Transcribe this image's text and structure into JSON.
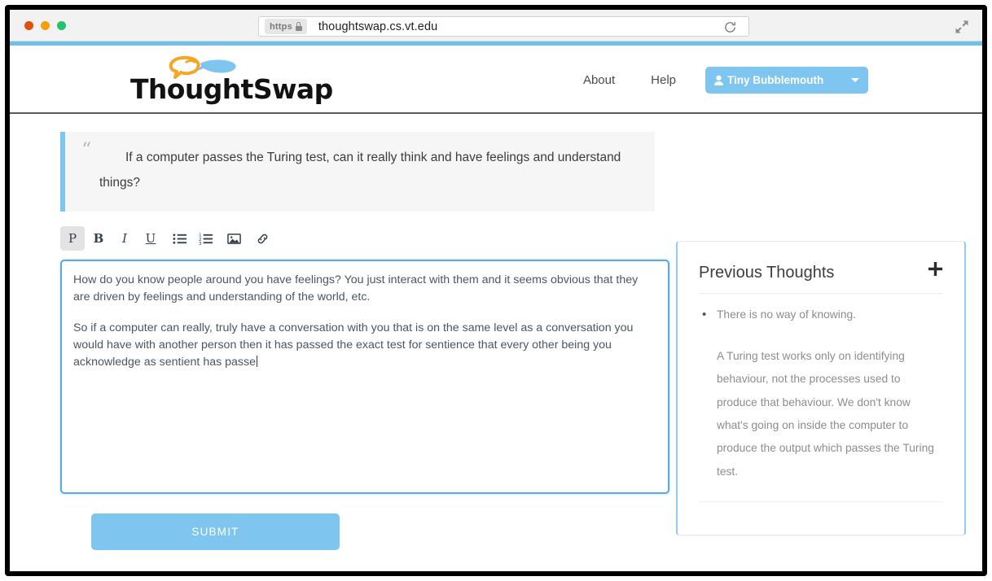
{
  "browser": {
    "scheme_badge": "https",
    "url": "thoughtswap.cs.vt.edu",
    "reload_icon": "reload-icon",
    "expand_icon": "fullscreen-icon"
  },
  "header": {
    "logo_text": "ThoughtSwap",
    "nav": [
      {
        "label": "About"
      },
      {
        "label": "Help"
      }
    ],
    "user": {
      "name": "Tiny Bubblemouth",
      "icon": "user-icon",
      "caret": "chevron-down-icon"
    }
  },
  "prompt": {
    "quote_glyph": "“",
    "text": "If a computer passes the Turing test, can it really think and have feelings and understand things?"
  },
  "toolbar": {
    "items": [
      {
        "name": "paragraph",
        "label": "P",
        "active": true
      },
      {
        "name": "bold",
        "label": "B",
        "active": false
      },
      {
        "name": "italic",
        "label": "I",
        "active": false
      },
      {
        "name": "underline",
        "label": "U",
        "active": false
      },
      {
        "name": "bullet-list",
        "label": "",
        "active": false
      },
      {
        "name": "numbered-list",
        "label": "",
        "active": false
      },
      {
        "name": "image",
        "label": "",
        "active": false
      },
      {
        "name": "link",
        "label": "",
        "active": false
      }
    ]
  },
  "editor": {
    "paragraph_1": "How do you know people around you have feelings? You just interact with them and it seems obvious that they are driven by feelings and understanding of the world, etc.",
    "paragraph_2": "So if a computer can really, truly have a conversation with you that is on the same level as a conversation you would have with another person then it has passed the exact test for sentience that every other being you acknowledge as sentient has passe"
  },
  "submit": {
    "label": "SUBMIT"
  },
  "panel": {
    "title": "Previous Thoughts",
    "add_icon": "plus-icon",
    "items": [
      "There is no way of knowing."
    ],
    "body": "A Turing test works only on identifying behaviour, not the processes used to produce that behaviour. We don't know what's going on inside the computer to produce the output which passes the Turing test."
  },
  "colors": {
    "accent_blue": "#7ec6ef",
    "strip_blue": "#6ec1e8",
    "editor_border": "#5aa8e8",
    "logo_orange": "#f5a623"
  }
}
